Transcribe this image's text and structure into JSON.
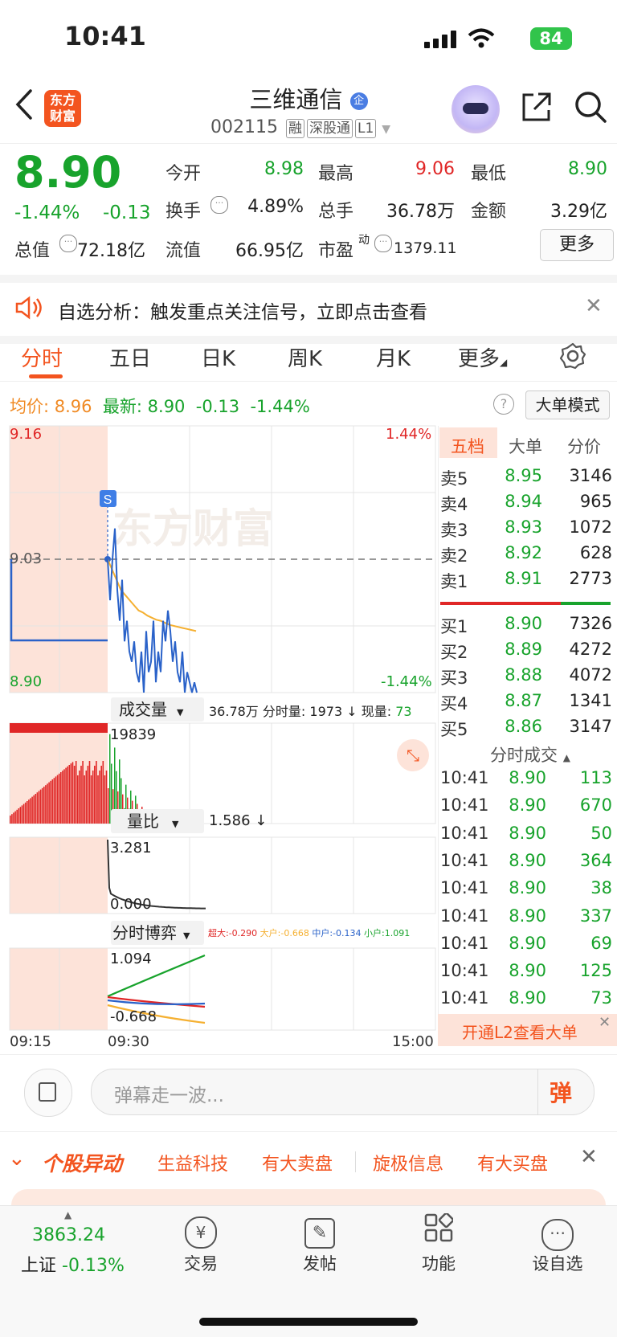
{
  "status": {
    "time": "10:41",
    "battery": "84"
  },
  "header": {
    "logo_text": "东方财富",
    "title": "三维通信",
    "title_badge": "企",
    "code": "002115",
    "tags": [
      "融",
      "深股通",
      "L1"
    ]
  },
  "quote": {
    "price": "8.90",
    "change_pct": "-1.44%",
    "change": "-0.13",
    "rows": [
      [
        {
          "label": "今开",
          "value": "8.98",
          "color": "green"
        },
        {
          "label": "最高",
          "value": "9.06",
          "color": "red"
        },
        {
          "label": "最低",
          "value": "8.90",
          "color": "green"
        }
      ],
      [
        {
          "label": "换手",
          "value": "4.89%",
          "color": "dark"
        },
        {
          "label": "总手",
          "value": "36.78万",
          "color": "dark"
        },
        {
          "label": "金额",
          "value": "3.29亿",
          "color": "dark"
        }
      ],
      [
        {
          "label": "总值",
          "value": "72.18亿",
          "color": "dark"
        },
        {
          "label": "流值",
          "value": "66.95亿",
          "color": "dark"
        },
        {
          "label": "市盈",
          "value": "1379.11",
          "color": "dark",
          "sup": "动"
        }
      ]
    ],
    "more_label": "更多"
  },
  "notice": {
    "text": "自选分析：触发重点关注信号，立即点击查看"
  },
  "tabs": [
    "分时",
    "五日",
    "日K",
    "周K",
    "月K",
    "更多"
  ],
  "info": {
    "avg_label": "均价:",
    "avg_value": "8.96",
    "latest_label": "最新:",
    "latest_value": "8.90",
    "latest_change": "-0.13",
    "latest_pct": "-1.44%",
    "mode_label": "大单模式"
  },
  "chart": {
    "y_high": "9.16",
    "y_ref": "9.03",
    "y_low": "8.90",
    "pct_high": "1.44%",
    "pct_low": "-1.44%",
    "marker": "S",
    "watermark": "东方财富",
    "vol_selector": "成交量",
    "vol_summary": "36.78万",
    "vol_period_label": "分时量:",
    "vol_period_value": "1973",
    "vol_now_label": "现量:",
    "vol_now_value": "73",
    "vol_max": "19839",
    "ratio_selector": "量比",
    "ratio_value": "1.586",
    "ratio_max": "3.281",
    "ratio_min": "0.000",
    "game_selector": "分时博弈",
    "game_legend": [
      {
        "label": "超大:-0.290",
        "color": "#e02727"
      },
      {
        "label": "大户:-0.668",
        "color": "#f5b031"
      },
      {
        "label": "中户:-0.134",
        "color": "#2a62c9"
      },
      {
        "label": "小户:1.091",
        "color": "#18a32c"
      }
    ],
    "game_max": "1.094",
    "game_min": "-0.668",
    "time_labels": [
      "09:15",
      "09:30",
      "15:00"
    ],
    "price_series": [
      9.03,
      8.99,
      9.03,
      9.06,
      9.0,
      8.97,
      9.01,
      8.95,
      8.97,
      8.94,
      8.93,
      8.95,
      8.92,
      8.91,
      8.94,
      8.9,
      8.96,
      8.92,
      8.93,
      8.97,
      8.91,
      8.94,
      8.92,
      8.97,
      8.95,
      8.98,
      8.96,
      8.93,
      8.95,
      8.92,
      8.91,
      8.94,
      8.9,
      8.92,
      8.91,
      8.9,
      8.91,
      8.9
    ],
    "avg_series": [
      9.03,
      9.02,
      9.01,
      9.0,
      8.995,
      8.99,
      8.985,
      8.98,
      8.978,
      8.975,
      8.973,
      8.971,
      8.97,
      8.968,
      8.966,
      8.965,
      8.964,
      8.963,
      8.962,
      8.961,
      8.96
    ]
  },
  "orderbook": {
    "headers": [
      "五档",
      "大单",
      "分价"
    ],
    "asks": [
      {
        "label": "卖5",
        "price": "8.95",
        "vol": "3146",
        "color": "green"
      },
      {
        "label": "卖4",
        "price": "8.94",
        "vol": "965",
        "color": "green"
      },
      {
        "label": "卖3",
        "price": "8.93",
        "vol": "1072",
        "color": "green"
      },
      {
        "label": "卖2",
        "price": "8.92",
        "vol": "628",
        "color": "green"
      },
      {
        "label": "卖1",
        "price": "8.91",
        "vol": "2773",
        "color": "green"
      }
    ],
    "bids": [
      {
        "label": "买1",
        "price": "8.90",
        "vol": "7326",
        "color": "green"
      },
      {
        "label": "买2",
        "price": "8.89",
        "vol": "4272",
        "color": "green"
      },
      {
        "label": "买3",
        "price": "8.88",
        "vol": "4072",
        "color": "green"
      },
      {
        "label": "买4",
        "price": "8.87",
        "vol": "1341",
        "color": "green"
      },
      {
        "label": "买5",
        "price": "8.86",
        "vol": "3147",
        "color": "green"
      }
    ],
    "ticks_title": "分时成交",
    "ticks": [
      {
        "time": "10:41",
        "price": "8.90",
        "vol": "113"
      },
      {
        "time": "10:41",
        "price": "8.90",
        "vol": "670"
      },
      {
        "time": "10:41",
        "price": "8.90",
        "vol": "50"
      },
      {
        "time": "10:41",
        "price": "8.90",
        "vol": "364"
      },
      {
        "time": "10:41",
        "price": "8.90",
        "vol": "38"
      },
      {
        "time": "10:41",
        "price": "8.90",
        "vol": "337"
      },
      {
        "time": "10:41",
        "price": "8.90",
        "vol": "69"
      },
      {
        "time": "10:41",
        "price": "8.90",
        "vol": "125"
      },
      {
        "time": "10:41",
        "price": "8.90",
        "vol": "73"
      }
    ],
    "l2_label": "开通L2查看大单"
  },
  "danmu": {
    "placeholder": "弹幕走一波...",
    "send_label": "弹"
  },
  "ticker": {
    "brand": "个股异动",
    "items": [
      "生益科技",
      "有大卖盘",
      "旋极信息",
      "有大买盘"
    ]
  },
  "nav": {
    "index_value": "3863.24",
    "index_name": "上证",
    "index_change": "-0.13%",
    "items": [
      {
        "label": "交易",
        "icon": "¥"
      },
      {
        "label": "发帖",
        "icon": "✎"
      },
      {
        "label": "功能",
        "icon": "▦"
      },
      {
        "label": "设自选",
        "icon": "⋯"
      }
    ]
  }
}
